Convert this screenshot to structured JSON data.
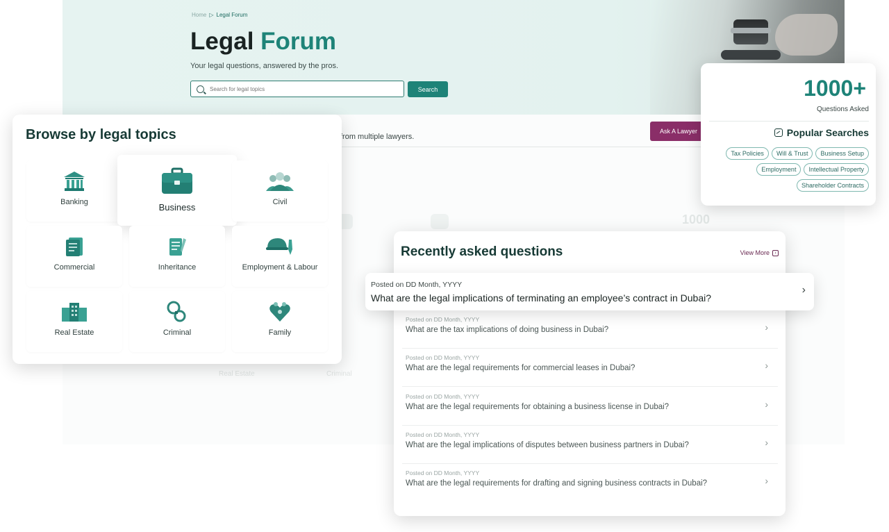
{
  "breadcrumb": {
    "home": "Home",
    "separator": "▷",
    "current": "Legal Forum"
  },
  "hero": {
    "title_main": "Legal",
    "title_accent": "Forum",
    "subtitle": "Your legal questions, answered by the pros.",
    "search_placeholder": "Search for legal topics",
    "search_button": "Search"
  },
  "background": {
    "lawyers_text": "from multiple lawyers.",
    "ask_button": "Ask A Lawyer",
    "faded_number": "1000",
    "faded_real_estate": "Real Estate",
    "faded_criminal": "Criminal"
  },
  "browse": {
    "title": "Browse by legal topics",
    "topics": [
      {
        "label": "Banking",
        "icon": "bank-icon"
      },
      {
        "label": "Business",
        "icon": "briefcase-icon"
      },
      {
        "label": "Civil",
        "icon": "people-icon"
      },
      {
        "label": "Commercial",
        "icon": "document-icon"
      },
      {
        "label": "Inheritance",
        "icon": "scroll-icon"
      },
      {
        "label": "Employment & Labour",
        "icon": "hardhat-icon"
      },
      {
        "label": "Real Estate",
        "icon": "building-icon"
      },
      {
        "label": "Criminal",
        "icon": "handcuffs-icon"
      },
      {
        "label": "Family",
        "icon": "family-heart-icon"
      }
    ]
  },
  "stats": {
    "number": "1000+",
    "label": "Questions Asked",
    "popular_title": "Popular Searches",
    "tags": [
      "Tax Policies",
      "Will & Trust",
      "Business Setup",
      "Employment",
      "Intellectual Property",
      "Shareholder Contracts"
    ]
  },
  "questions": {
    "title": "Recently asked questions",
    "view_more": "View More",
    "featured": {
      "date": "Posted on DD Month, YYYY",
      "text": "What are the legal implications of terminating an employee’s contract in Dubai?"
    },
    "items": [
      {
        "date": "Posted on DD Month, YYYY",
        "text": "What are the tax implications of doing business in Dubai?"
      },
      {
        "date": "Posted on DD Month, YYYY",
        "text": "What are the legal requirements for commercial leases in Dubai?"
      },
      {
        "date": "Posted on DD Month, YYYY",
        "text": "What are the legal requirements for obtaining a business license in Dubai?"
      },
      {
        "date": "Posted on DD Month, YYYY",
        "text": "What are the legal implications of disputes between business partners in Dubai?"
      },
      {
        "date": "Posted on DD Month, YYYY",
        "text": "What are the legal requirements for drafting and signing business contracts in Dubai?"
      }
    ]
  },
  "colors": {
    "brand": "#1e8378",
    "ask": "#8a2e68",
    "heading": "#173a35"
  }
}
